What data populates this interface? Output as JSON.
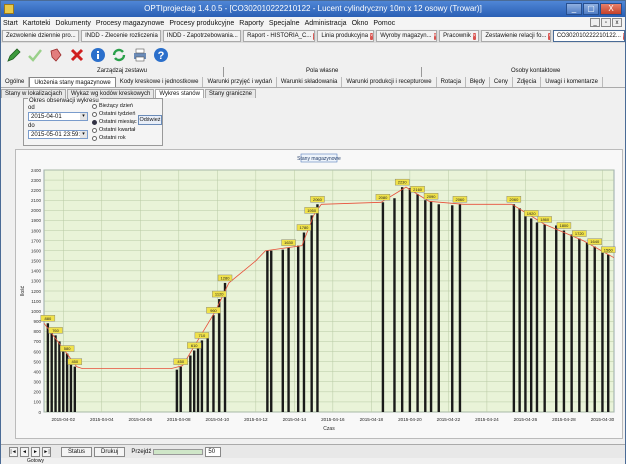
{
  "window": {
    "title": "OPTIprojectag 1.4.0.5 - [CO302010222210122 - Lucent cylindryczny 10m x 12 osowy (Trowar)]",
    "buttons": [
      "_",
      "▢",
      "X"
    ]
  },
  "menu": [
    "Start",
    "Kartoteki",
    "Dokumenty",
    "Procesy magazynowe",
    "Procesy produkcyjne",
    "Raporty",
    "Specjalne",
    "Administracja",
    "Okno",
    "Pomoc"
  ],
  "doc_tabs": [
    {
      "label": "Zezwolenie dziennie pro...",
      "active": false
    },
    {
      "label": "INDD - Zlecenie rozliczenia",
      "active": false
    },
    {
      "label": "INDD - Zapotrzebowania...",
      "active": false
    },
    {
      "label": "Raport - HISTORIA_C...",
      "active": false
    },
    {
      "label": "Linia produkcyjna",
      "active": false
    },
    {
      "label": "Wyroby magazyn...",
      "active": false
    },
    {
      "label": "Pracownik",
      "active": false
    },
    {
      "label": "Zestawienie relacji fo...",
      "active": false
    },
    {
      "label": "CO302010222210122...",
      "active": true
    }
  ],
  "toolbar_icons": [
    "pencil-icon",
    "check-icon",
    "eraser-icon",
    "delete-icon",
    "info-icon",
    "refresh-icon",
    "print-icon",
    "help-icon"
  ],
  "group_headers": [
    "Zarządzaj zestawu",
    "Pola własne",
    "Osoby kontaktowe"
  ],
  "sub_tabs": [
    {
      "label": "Ogólne",
      "active": false
    },
    {
      "label": "Ułożenia stany magazynowe",
      "active": true
    },
    {
      "label": "Kody kreskowe i jednostkowe",
      "active": false
    },
    {
      "label": "Warunki przyjęć i wydań",
      "active": false
    },
    {
      "label": "Warunki składowania",
      "active": false
    },
    {
      "label": "Warunki produkcji i recepturowe",
      "active": false
    },
    {
      "label": "Rotacja",
      "active": false
    },
    {
      "label": "Błędy",
      "active": false
    },
    {
      "label": "Ceny",
      "active": false
    },
    {
      "label": "Zdjęcia",
      "active": false
    },
    {
      "label": "Uwagi i komentarze",
      "active": false
    }
  ],
  "sub_tabs2": [
    {
      "label": "Stany w lokalizacjach",
      "active": false
    },
    {
      "label": "Wykaz wg kodów kreskowych",
      "active": false
    },
    {
      "label": "Wykres stanów",
      "active": true
    },
    {
      "label": "Stany graniczne",
      "active": false
    }
  ],
  "filter": {
    "legend": "Okres obserwacji wykresu",
    "from_label": "od",
    "from_value": "2015-04-01",
    "to_label": "do",
    "to_value": "2015-05-01 23:59:59",
    "options": [
      "Bieżący dzień",
      "Ostatni tydzień",
      "Ostatni miesiąc",
      "Ostatni kwartał",
      "Ostatni rok"
    ],
    "selected_option": "Ostatni miesiąc",
    "ok_button": "Odśwież"
  },
  "chart_data": {
    "type": "bar",
    "title": "Stany magazynowe",
    "xlabel": "Czas",
    "ylabel": "Ilość",
    "ylim": [
      0,
      2400
    ],
    "yticks": [
      0,
      100,
      200,
      300,
      400,
      500,
      600,
      700,
      800,
      900,
      1000,
      1100,
      1200,
      1300,
      1400,
      1500,
      1600,
      1700,
      1800,
      1900,
      2000,
      2100,
      2200,
      2300,
      2400
    ],
    "xticks": [
      "2015-04-02",
      "2015-04-04",
      "2015-04-06",
      "2015-04-08",
      "2015-04-10",
      "2015-04-12",
      "2015-04-14",
      "2015-04-16",
      "2015-04-18",
      "2015-04-20",
      "2015-04-22",
      "2015-04-24",
      "2015-04-26",
      "2015-04-28",
      "2015-04-30"
    ],
    "xlim": [
      1.0,
      30.6
    ],
    "bars": [
      {
        "x": 1.2,
        "v": 880
      },
      {
        "x": 1.4,
        "v": 820
      },
      {
        "x": 1.6,
        "v": 760
      },
      {
        "x": 1.8,
        "v": 700
      },
      {
        "x": 2.0,
        "v": 640
      },
      {
        "x": 2.2,
        "v": 580
      },
      {
        "x": 2.4,
        "v": 520
      },
      {
        "x": 2.6,
        "v": 450
      },
      {
        "x": 7.9,
        "v": 420
      },
      {
        "x": 8.1,
        "v": 450
      },
      {
        "x": 8.6,
        "v": 560
      },
      {
        "x": 8.8,
        "v": 610
      },
      {
        "x": 9.0,
        "v": 660
      },
      {
        "x": 9.2,
        "v": 710
      },
      {
        "x": 9.5,
        "v": 770
      },
      {
        "x": 9.8,
        "v": 960
      },
      {
        "x": 10.1,
        "v": 1120
      },
      {
        "x": 10.4,
        "v": 1280
      },
      {
        "x": 12.6,
        "v": 1600
      },
      {
        "x": 12.8,
        "v": 1600
      },
      {
        "x": 13.4,
        "v": 1610
      },
      {
        "x": 13.7,
        "v": 1630
      },
      {
        "x": 14.2,
        "v": 1650
      },
      {
        "x": 14.5,
        "v": 1780
      },
      {
        "x": 14.9,
        "v": 1950
      },
      {
        "x": 15.2,
        "v": 2060
      },
      {
        "x": 18.6,
        "v": 2080
      },
      {
        "x": 19.2,
        "v": 2120
      },
      {
        "x": 19.6,
        "v": 2230
      },
      {
        "x": 20.0,
        "v": 2220
      },
      {
        "x": 20.4,
        "v": 2160
      },
      {
        "x": 20.8,
        "v": 2100
      },
      {
        "x": 21.1,
        "v": 2090
      },
      {
        "x": 21.5,
        "v": 2060
      },
      {
        "x": 22.2,
        "v": 2050
      },
      {
        "x": 22.6,
        "v": 2060
      },
      {
        "x": 25.4,
        "v": 2060
      },
      {
        "x": 25.7,
        "v": 2020
      },
      {
        "x": 26.0,
        "v": 1960
      },
      {
        "x": 26.3,
        "v": 1920
      },
      {
        "x": 26.6,
        "v": 1880
      },
      {
        "x": 27.0,
        "v": 1860
      },
      {
        "x": 27.6,
        "v": 1850
      },
      {
        "x": 28.0,
        "v": 1800
      },
      {
        "x": 28.4,
        "v": 1760
      },
      {
        "x": 28.8,
        "v": 1720
      },
      {
        "x": 29.2,
        "v": 1680
      },
      {
        "x": 29.6,
        "v": 1640
      },
      {
        "x": 30.0,
        "v": 1600
      },
      {
        "x": 30.3,
        "v": 1560
      }
    ],
    "line": [
      [
        1.0,
        880
      ],
      [
        2.7,
        450
      ],
      [
        3.0,
        430
      ],
      [
        7.6,
        430
      ],
      [
        8.2,
        460
      ],
      [
        9.9,
        1000
      ],
      [
        10.6,
        1280
      ],
      [
        12.0,
        1500
      ],
      [
        12.5,
        1600
      ],
      [
        14.4,
        1650
      ],
      [
        15.0,
        1950
      ],
      [
        15.4,
        2060
      ],
      [
        18.5,
        2080
      ],
      [
        19.8,
        2230
      ],
      [
        21.0,
        2090
      ],
      [
        22.8,
        2060
      ],
      [
        25.3,
        2060
      ],
      [
        27.0,
        1860
      ],
      [
        29.0,
        1700
      ],
      [
        30.6,
        1530
      ]
    ],
    "labels": [
      {
        "x": 1.2,
        "v": 880,
        "t": "880"
      },
      {
        "x": 1.6,
        "v": 760,
        "t": "760"
      },
      {
        "x": 2.2,
        "v": 580,
        "t": "580"
      },
      {
        "x": 2.6,
        "v": 450,
        "t": "450"
      },
      {
        "x": 8.1,
        "v": 450,
        "t": "450"
      },
      {
        "x": 8.8,
        "v": 610,
        "t": "610"
      },
      {
        "x": 9.2,
        "v": 710,
        "t": "710"
      },
      {
        "x": 9.8,
        "v": 960,
        "t": "960"
      },
      {
        "x": 10.1,
        "v": 1120,
        "t": "1120"
      },
      {
        "x": 10.4,
        "v": 1280,
        "t": "1280"
      },
      {
        "x": 13.7,
        "v": 1630,
        "t": "1630"
      },
      {
        "x": 14.5,
        "v": 1780,
        "t": "1780"
      },
      {
        "x": 14.9,
        "v": 1950,
        "t": "1950"
      },
      {
        "x": 15.2,
        "v": 2060,
        "t": "2060"
      },
      {
        "x": 18.6,
        "v": 2080,
        "t": "2080"
      },
      {
        "x": 19.6,
        "v": 2230,
        "t": "2230"
      },
      {
        "x": 20.4,
        "v": 2160,
        "t": "2160"
      },
      {
        "x": 21.1,
        "v": 2090,
        "t": "2090"
      },
      {
        "x": 22.6,
        "v": 2060,
        "t": "2060"
      },
      {
        "x": 25.4,
        "v": 2060,
        "t": "2060"
      },
      {
        "x": 26.3,
        "v": 1920,
        "t": "1920"
      },
      {
        "x": 27.0,
        "v": 1860,
        "t": "1860"
      },
      {
        "x": 28.0,
        "v": 1800,
        "t": "1800"
      },
      {
        "x": 28.8,
        "v": 1720,
        "t": "1720"
      },
      {
        "x": 29.6,
        "v": 1640,
        "t": "1640"
      },
      {
        "x": 30.3,
        "v": 1560,
        "t": "1560"
      }
    ],
    "grid": true,
    "bar_color": "#1a1a1a",
    "line_color": "#e8503a",
    "label_color": "#f0e24a",
    "plot_bg": "#e9f3d8"
  },
  "bottom": {
    "nav": [
      "|◄",
      "◄",
      "►",
      "►|"
    ],
    "status_button": "Status",
    "print_button": "Drukuj",
    "progress_label": "Przejdź",
    "value": "50"
  },
  "status_text": "Gotowy"
}
